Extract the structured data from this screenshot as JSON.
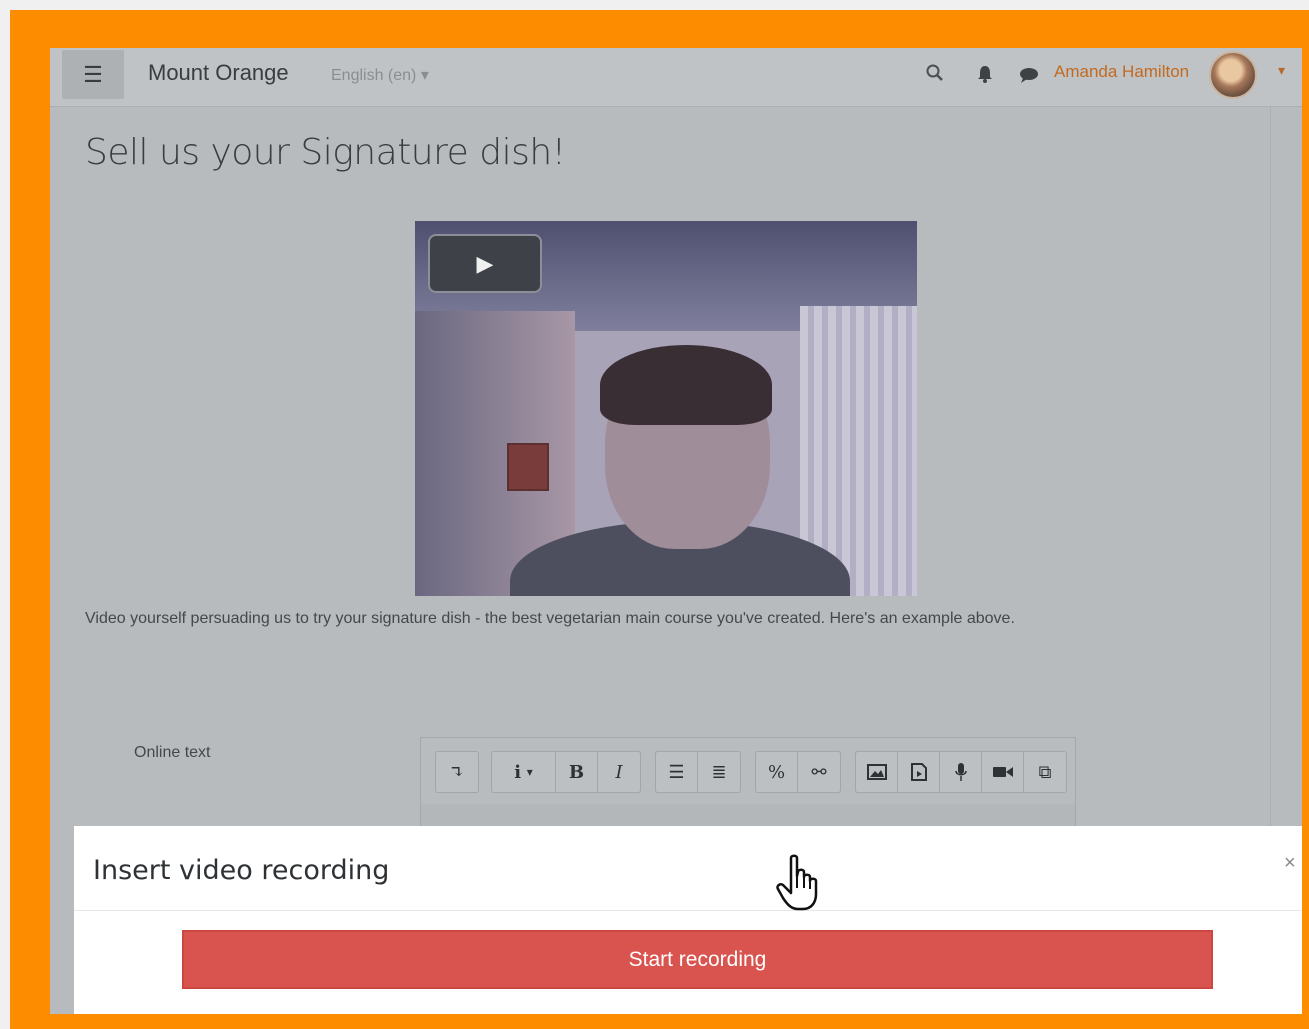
{
  "navbar": {
    "menu_icon": "hamburger-menu-icon",
    "site_name": "Mount Orange",
    "language": "English (en)",
    "user_name": "Amanda Hamilton"
  },
  "page": {
    "title": "Sell us your Signature dish!",
    "description": "Video yourself persuading us to try your signature dish - the best vegetarian main course you've created. Here's an example above."
  },
  "form": {
    "online_text_label": "Online text"
  },
  "toolbar": {
    "buttons": [
      "show-more",
      "paragraph-styles",
      "bold",
      "italic",
      "unordered-list",
      "ordered-list",
      "link",
      "unlink",
      "image",
      "media",
      "record-audio",
      "record-video",
      "manage-files"
    ]
  },
  "modal": {
    "title": "Insert video recording",
    "close_label": "×",
    "start_label": "Start recording"
  },
  "colors": {
    "frame": "#fd8c00",
    "record_button": "#d9534f",
    "user_link": "#c26a22"
  }
}
